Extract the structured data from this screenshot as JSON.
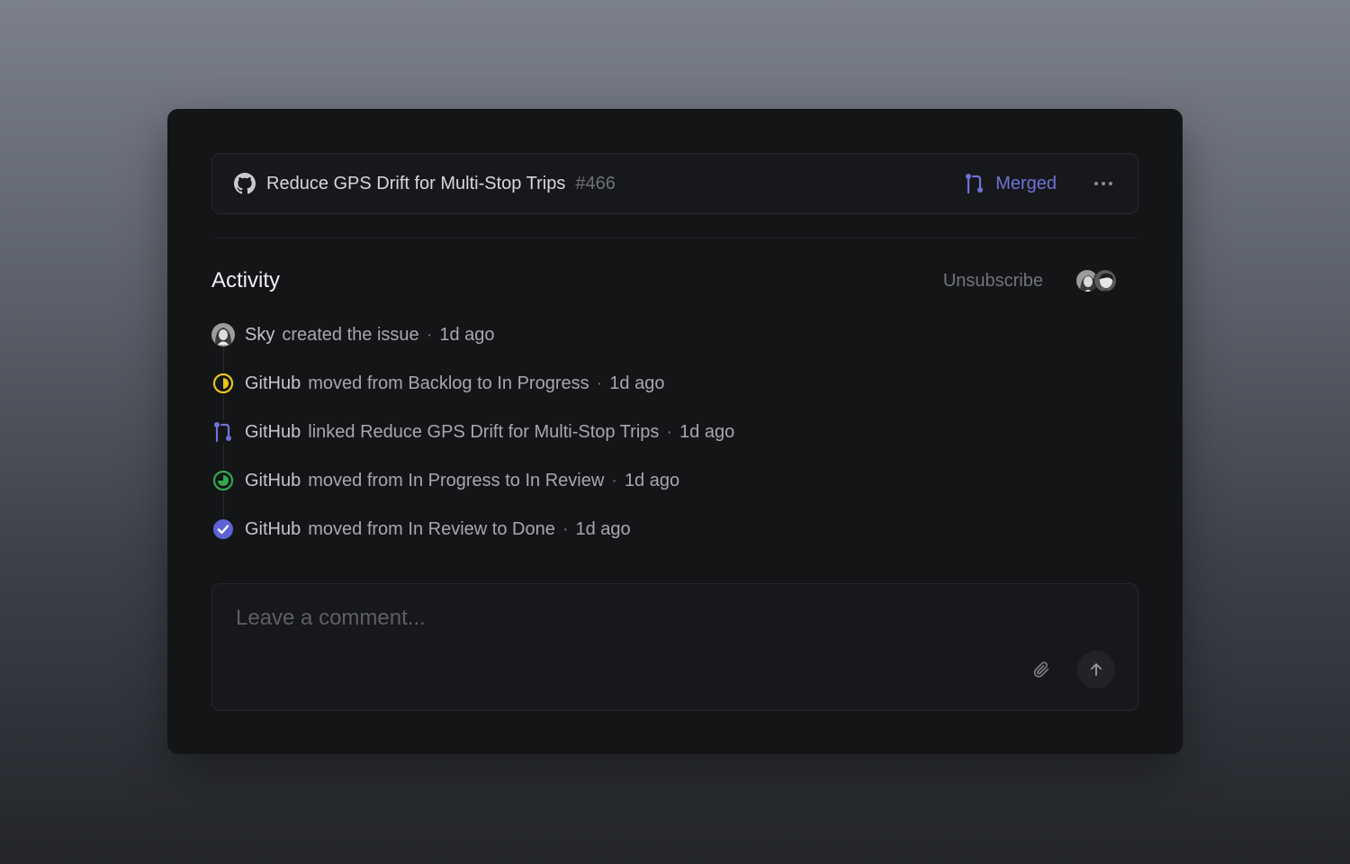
{
  "pr": {
    "title": "Reduce GPS Drift for Multi-Stop Trips",
    "number": "#466",
    "status": "Merged",
    "status_color": "#6f72d8",
    "icon": "github-icon"
  },
  "activity": {
    "title": "Activity",
    "unsubscribe_label": "Unsubscribe",
    "subscribers": [
      "avatar-sky",
      "avatar-user-2"
    ],
    "events": [
      {
        "icon": "user-avatar",
        "actor": "Sky",
        "text": "created the issue",
        "time": "1d ago"
      },
      {
        "icon": "in-progress-icon",
        "icon_color": "#e8c519",
        "actor": "GitHub",
        "text": "moved from Backlog to In Progress",
        "time": "1d ago"
      },
      {
        "icon": "pull-request-icon",
        "icon_color": "#6f72d8",
        "actor": "GitHub",
        "text": "linked Reduce GPS Drift for Multi-Stop Trips",
        "time": "1d ago"
      },
      {
        "icon": "in-review-icon",
        "icon_color": "#2fa84f",
        "actor": "GitHub",
        "text": "moved from In Progress to In Review",
        "time": "1d ago"
      },
      {
        "icon": "done-check-icon",
        "icon_color": "#5e62d6",
        "actor": "GitHub",
        "text": "moved from In Review to Done",
        "time": "1d ago"
      }
    ],
    "separator": "·"
  },
  "comment": {
    "placeholder": "Leave a comment...",
    "value": ""
  }
}
